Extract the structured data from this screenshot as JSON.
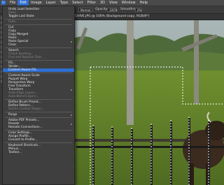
{
  "menubar": {
    "items": [
      "File",
      "Edit",
      "Image",
      "Layer",
      "Type",
      "Select",
      "Filter",
      "3D",
      "View",
      "Window",
      "Help"
    ],
    "active_index": 1
  },
  "options_bar": {
    "mode_value": "Normal",
    "opacity_label": "Opacity:",
    "opacity_value": "100%",
    "smoothing_label": "Smoothing:",
    "smoothing_value": "0%"
  },
  "document_tab": {
    "title": "ARCHIVE.JPG @ 100% (Background copy, RGB/8*)"
  },
  "edit_menu": {
    "items": [
      {
        "label": "Undo Load Selection",
        "shortcut": "",
        "dim": false
      },
      {
        "label": "Redo",
        "shortcut": "",
        "dim": true
      },
      {
        "label": "Toggle Last State",
        "shortcut": "",
        "dim": false
      },
      {
        "sep": true
      },
      {
        "label": "Fade...",
        "shortcut": "",
        "dim": true
      },
      {
        "sep": true
      },
      {
        "label": "Cut",
        "shortcut": "",
        "dim": false
      },
      {
        "label": "Copy",
        "shortcut": "",
        "dim": false
      },
      {
        "label": "Copy Merged",
        "shortcut": "",
        "dim": false
      },
      {
        "label": "Paste",
        "shortcut": "",
        "dim": false
      },
      {
        "label": "Paste Special",
        "shortcut": "",
        "dim": false,
        "submenu": true
      },
      {
        "label": "Clear",
        "shortcut": "",
        "dim": false
      },
      {
        "sep": true
      },
      {
        "label": "Search",
        "shortcut": "",
        "dim": false
      },
      {
        "label": "Check Spelling...",
        "shortcut": "",
        "dim": true
      },
      {
        "label": "Find and Replace Text...",
        "shortcut": "",
        "dim": true
      },
      {
        "sep": true
      },
      {
        "label": "Fill...",
        "shortcut": "",
        "dim": false
      },
      {
        "label": "Stroke...",
        "shortcut": "",
        "dim": false
      },
      {
        "label": "Content-Aware Fill...",
        "shortcut": "",
        "dim": false,
        "highlight": true
      },
      {
        "sep": true
      },
      {
        "label": "Content-Aware Scale",
        "shortcut": "",
        "dim": false
      },
      {
        "label": "Puppet Warp",
        "shortcut": "",
        "dim": false
      },
      {
        "label": "Perspective Warp",
        "shortcut": "",
        "dim": false
      },
      {
        "label": "Free Transform",
        "shortcut": "",
        "dim": false
      },
      {
        "label": "Transform",
        "shortcut": "",
        "dim": false,
        "submenu": true
      },
      {
        "label": "Auto-Align Layers...",
        "shortcut": "",
        "dim": true
      },
      {
        "label": "Auto-Blend Layers...",
        "shortcut": "",
        "dim": true
      },
      {
        "sep": true
      },
      {
        "label": "Define Brush Preset...",
        "shortcut": "",
        "dim": false
      },
      {
        "label": "Define Pattern...",
        "shortcut": "",
        "dim": false
      },
      {
        "label": "Define Custom Shape...",
        "shortcut": "",
        "dim": true
      },
      {
        "sep": true
      },
      {
        "label": "Purge",
        "shortcut": "",
        "dim": false,
        "submenu": true
      },
      {
        "sep": true
      },
      {
        "label": "Adobe PDF Presets...",
        "shortcut": "",
        "dim": false
      },
      {
        "label": "Presets",
        "shortcut": "",
        "dim": false,
        "submenu": true
      },
      {
        "label": "Remote Connections...",
        "shortcut": "",
        "dim": false
      },
      {
        "sep": true
      },
      {
        "label": "Color Settings...",
        "shortcut": "",
        "dim": false
      },
      {
        "label": "Assign Profile...",
        "shortcut": "",
        "dim": false
      },
      {
        "label": "Convert to Profile...",
        "shortcut": "",
        "dim": false
      },
      {
        "sep": true
      },
      {
        "label": "Keyboard Shortcuts...",
        "shortcut": "",
        "dim": false
      },
      {
        "label": "Menus...",
        "shortcut": "",
        "dim": false
      },
      {
        "label": "Toolbar...",
        "shortcut": "",
        "dim": false
      }
    ]
  },
  "colors": {
    "accent": "#2f6fd0",
    "menu_bg": "#3f3f3f"
  }
}
